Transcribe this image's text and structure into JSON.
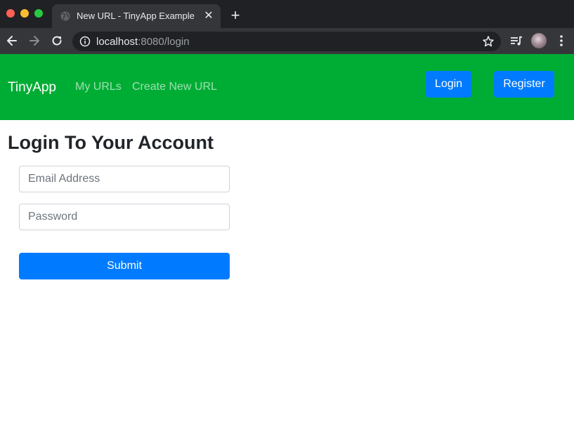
{
  "browser": {
    "tab": {
      "title": "New URL - TinyApp Example",
      "close_glyph": "✕",
      "favicon": "globe-icon"
    },
    "new_tab_glyph": "+",
    "address_bar": {
      "host": "localhost",
      "rest": ":8080/login"
    },
    "icons": [
      "back-arrow-icon",
      "forward-arrow-icon",
      "reload-icon",
      "info-icon",
      "star-icon",
      "media-queue-icon",
      "avatar",
      "kebab-menu-icon"
    ]
  },
  "navbar": {
    "brand": "TinyApp",
    "links": [
      {
        "label": "My URLs"
      },
      {
        "label": "Create New URL"
      }
    ],
    "login_label": "Login",
    "register_label": "Register"
  },
  "form": {
    "title": "Login To Your Account",
    "email_placeholder": "Email Address",
    "email_value": "",
    "password_placeholder": "Password",
    "password_value": "",
    "submit_label": "Submit"
  },
  "colors": {
    "navbar_bg": "#00ad34",
    "primary_button": "#007bff",
    "chrome_dark": "#202124",
    "chrome_toolbar": "#35363a"
  }
}
